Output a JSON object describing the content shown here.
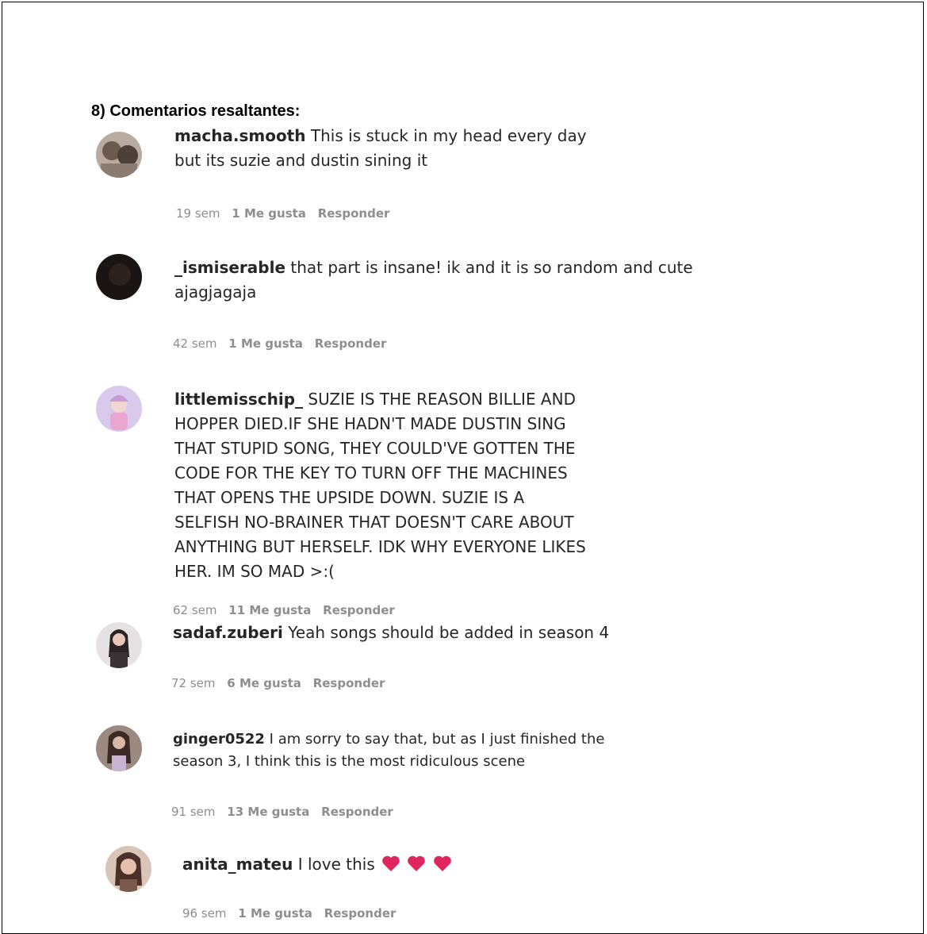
{
  "heading": "8) Comentarios resaltantes:",
  "colors": {
    "heart": "#e0245e",
    "meta": "#8e8e8e",
    "text": "#262626"
  },
  "comments": [
    {
      "username": "macha.smooth",
      "text": "This is stuck in my head every day but its suzie and dustin sining it",
      "time": "19 sem",
      "likes": "1 Me gusta",
      "reply": "Responder",
      "avatar": "avatar-photo-icon"
    },
    {
      "username": "_ismiserable",
      "text": "that part is insane! ik and it is so random and cute ajagjagaja",
      "time": "42 sem",
      "likes": "1 Me gusta",
      "reply": "Responder",
      "avatar": "avatar-photo-icon"
    },
    {
      "username": "littlemisschip_",
      "text": "SUZIE IS THE REASON BILLIE AND HOPPER DIED.IF SHE HADN'T MADE DUSTIN SING THAT STUPID SONG, THEY COULD'VE GOTTEN THE CODE FOR THE KEY TO TURN OFF THE MACHINES THAT OPENS THE UPSIDE DOWN. SUZIE IS A SELFISH NO-BRAINER THAT DOESN'T CARE ABOUT ANYTHING BUT HERSELF. IDK WHY EVERYONE LIKES HER. IM SO MAD >:(",
      "time": "62 sem",
      "likes": "11 Me gusta",
      "reply": "Responder",
      "avatar": "avatar-photo-icon"
    },
    {
      "username": "sadaf.zuberi",
      "text": "Yeah songs should be added in season 4",
      "time": "72 sem",
      "likes": "6 Me gusta",
      "reply": "Responder",
      "avatar": "avatar-photo-icon"
    },
    {
      "username": "ginger0522",
      "text": "I am sorry to say that, but as I just finished the season 3, I think this is the most ridiculous scene",
      "time": "91 sem",
      "likes": "13 Me gusta",
      "reply": "Responder",
      "avatar": "avatar-photo-icon"
    },
    {
      "username": "anita_mateu",
      "text": "I love this",
      "time": "96 sem",
      "likes": "1 Me gusta",
      "reply": "Responder",
      "avatar": "avatar-photo-icon",
      "emoji": [
        "heart-emoji-icon",
        "heart-emoji-icon",
        "heart-emoji-icon"
      ]
    }
  ]
}
